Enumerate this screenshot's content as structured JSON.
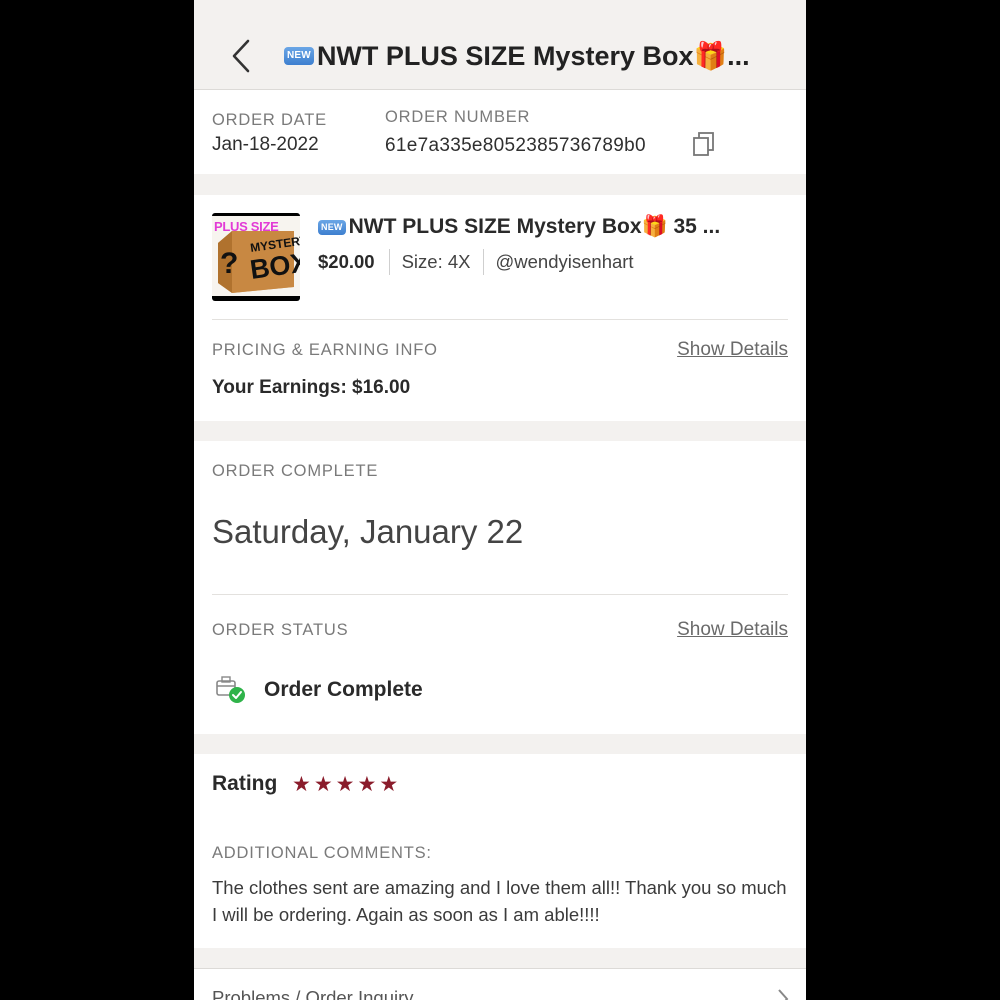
{
  "header": {
    "badge": "NEW",
    "title": "NWT PLUS SIZE Mystery Box🎁..."
  },
  "order": {
    "date_label": "ORDER DATE",
    "date": "Jan-18-2022",
    "number_label": "ORDER NUMBER",
    "number": "61e7a335e8052385736789b0"
  },
  "item": {
    "thumb": {
      "line1": "PLUS SIZE",
      "line2": "MYSTERY",
      "line3": "BOX",
      "q": "?"
    },
    "badge": "NEW",
    "title": "NWT PLUS SIZE Mystery Box🎁 35 ...",
    "price": "$20.00",
    "size": "Size: 4X",
    "seller": "@wendyisenhart"
  },
  "pricing": {
    "label": "PRICING & EARNING INFO",
    "show_details": "Show Details",
    "earnings": "Your Earnings: $16.00"
  },
  "complete": {
    "label": "ORDER COMPLETE",
    "date": "Saturday, January 22"
  },
  "status": {
    "label": "ORDER STATUS",
    "show_details": "Show Details",
    "text": "Order Complete"
  },
  "rating": {
    "label": "Rating",
    "stars": 5,
    "comments_label": "ADDITIONAL COMMENTS:",
    "comment": "The clothes sent are amazing and I love them all!! Thank you so much I will be ordering. Again as soon as I am able!!!!"
  },
  "problems": {
    "label": "Problems / Order Inquiry"
  },
  "colors": {
    "star": "#8a1c2b",
    "check": "#2fb34a",
    "background": "#f3f1ef"
  }
}
